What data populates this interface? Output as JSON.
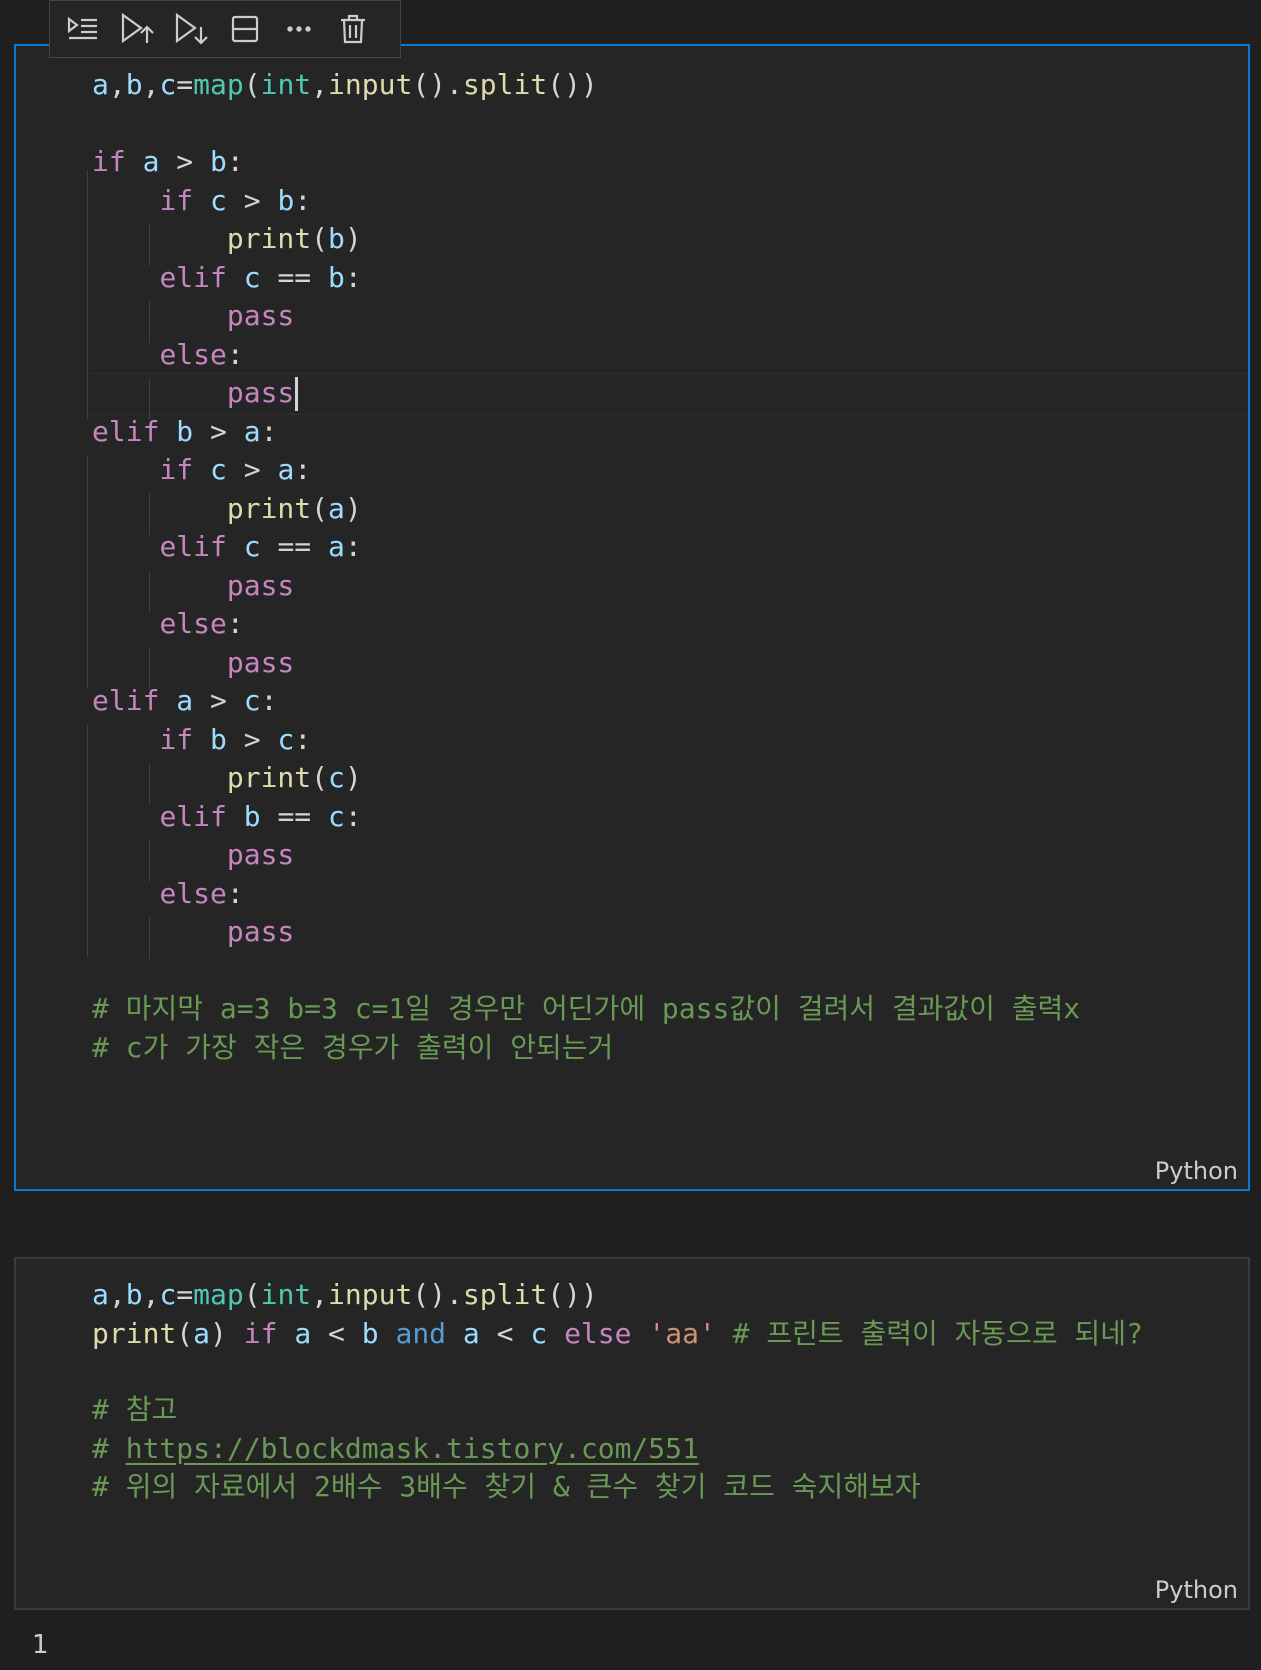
{
  "toolbar": {
    "buttons": [
      {
        "name": "execute-above-cells-button",
        "icon": "run-by-line-icon"
      },
      {
        "name": "execute-cell-and-above-button",
        "icon": "run-above-icon"
      },
      {
        "name": "execute-cell-and-below-button",
        "icon": "run-below-icon"
      },
      {
        "name": "split-cell-button",
        "icon": "split-icon"
      },
      {
        "name": "more-actions-button",
        "icon": "ellipsis-icon"
      },
      {
        "name": "delete-cell-button",
        "icon": "trash-icon"
      }
    ]
  },
  "cells": [
    {
      "language": "Python",
      "lines": [
        "a,b,c=map(int,input().split())",
        "",
        "if a > b:",
        "    if c > b:",
        "        print(b)",
        "    elif c == b:",
        "        pass",
        "    else:",
        "        pass",
        "elif b > a:",
        "    if c > a:",
        "        print(a)",
        "    elif c == a:",
        "        pass",
        "    else:",
        "        pass",
        "elif a > c:",
        "    if b > c:",
        "        print(c)",
        "    elif b == c:",
        "        pass",
        "    else:",
        "        pass",
        "",
        "# 마지막 a=3 b=3 c=1일 경우만 어딘가에 pass값이 걸려서 결과값이 출력x",
        "# c가 가장 작은 경우가 출력이 안되는거"
      ]
    },
    {
      "language": "Python",
      "lines": [
        "a,b,c=map(int,input().split())",
        "print(a) if a < b and a < c else 'aa' # 프린트 출력이 자동으로 되네?",
        "",
        "# 참고",
        "# https://blockdmask.tistory.com/551",
        "# 위의 자료에서 2배수 3배수 찾기 & 큰수 찾기 코드 숙지해보자"
      ]
    }
  ],
  "output": {
    "text": "1"
  },
  "colors": {
    "keyword": "#c586c0",
    "variable": "#9cdcfe",
    "function": "#dcdcaa",
    "builtin_type": "#4ec9b0",
    "comment": "#6a9955",
    "string": "#ce9178",
    "active_border": "#0a7ad4"
  }
}
